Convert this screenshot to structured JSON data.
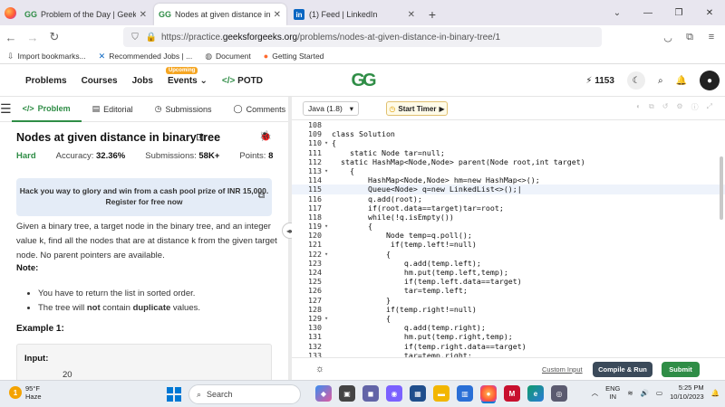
{
  "browser": {
    "tabs": [
      {
        "title": "Problem of the Day | GeeksforG",
        "icon": "gfg"
      },
      {
        "title": "Nodes at given distance in bina",
        "icon": "gfg"
      },
      {
        "title": "(1) Feed | LinkedIn",
        "icon": "linkedin"
      }
    ],
    "url_prefix": "https://practice.",
    "url_domain": "geeksforgeeks.org",
    "url_path": "/problems/nodes-at-given-distance-in-binary-tree/1",
    "bookmarks": [
      "Import bookmarks...",
      "Recommended Jobs | ...",
      "Document",
      "Getting Started"
    ]
  },
  "site": {
    "nav": [
      "Problems",
      "Courses",
      "Jobs",
      "Events",
      "POTD"
    ],
    "events_badge": "Upcoming",
    "logo": "GG",
    "streak": "1153"
  },
  "problem": {
    "tabs": [
      "Problem",
      "Editorial",
      "Submissions",
      "Comments"
    ],
    "title": "Nodes at given distance in binary tree",
    "difficulty": "Hard",
    "accuracy_label": "Accuracy:",
    "accuracy": "32.36%",
    "submissions_label": "Submissions:",
    "submissions": "58K+",
    "points_label": "Points:",
    "points": "8",
    "promo_line1": "Hack you way to glory and win from a cash pool prize of INR 15,000.",
    "promo_line2": "Register for free now",
    "description": "Given a binary tree, a target node in the binary tree, and an integer value k, find all the nodes that are at distance k from the given target node. No parent pointers are available.",
    "note_label": "Note:",
    "note1": "You have to return the list in sorted order.",
    "note2_pre": "The tree will ",
    "note2_not": "not",
    "note2_mid": " contain ",
    "note2_dup": "duplicate",
    "note2_post": " values.",
    "example_label": "Example 1:",
    "input_label": "Input:",
    "input_value": "20"
  },
  "editor": {
    "language": "Java (1.8)",
    "timer_label": "Start Timer",
    "lines": [
      {
        "n": "108",
        "f": "",
        "c": ""
      },
      {
        "n": "109",
        "f": "",
        "c": "class Solution"
      },
      {
        "n": "110",
        "f": "▾",
        "c": "{"
      },
      {
        "n": "111",
        "f": "",
        "c": "    static Node tar=null;"
      },
      {
        "n": "112",
        "f": "",
        "c": "  static HashMap<Node,Node> parent(Node root,int target)"
      },
      {
        "n": "113",
        "f": "▾",
        "c": "    {"
      },
      {
        "n": "114",
        "f": "",
        "c": "        HashMap<Node,Node> hm=new HashMap<>();"
      },
      {
        "n": "115",
        "f": "",
        "c": "        Queue<Node> q=new LinkedList<>();|"
      },
      {
        "n": "116",
        "f": "",
        "c": "        q.add(root);"
      },
      {
        "n": "117",
        "f": "",
        "c": "        if(root.data==target)tar=root;"
      },
      {
        "n": "118",
        "f": "",
        "c": "        while(!q.isEmpty())"
      },
      {
        "n": "119",
        "f": "▾",
        "c": "        {"
      },
      {
        "n": "120",
        "f": "",
        "c": "            Node temp=q.poll();"
      },
      {
        "n": "121",
        "f": "",
        "c": "             if(temp.left!=null)"
      },
      {
        "n": "122",
        "f": "▾",
        "c": "            {"
      },
      {
        "n": "123",
        "f": "",
        "c": "                q.add(temp.left);"
      },
      {
        "n": "124",
        "f": "",
        "c": "                hm.put(temp.left,temp);"
      },
      {
        "n": "125",
        "f": "",
        "c": "                if(temp.left.data==target)"
      },
      {
        "n": "126",
        "f": "",
        "c": "                tar=temp.left;"
      },
      {
        "n": "127",
        "f": "",
        "c": "            }"
      },
      {
        "n": "128",
        "f": "",
        "c": "            if(temp.right!=null)"
      },
      {
        "n": "129",
        "f": "▾",
        "c": "            {"
      },
      {
        "n": "130",
        "f": "",
        "c": "                q.add(temp.right);"
      },
      {
        "n": "131",
        "f": "",
        "c": "                hm.put(temp.right,temp);"
      },
      {
        "n": "132",
        "f": "",
        "c": "                if(temp.right.data==target)"
      },
      {
        "n": "133",
        "f": "",
        "c": "                tar=temp.right;"
      }
    ],
    "custom_input": "Custom Input",
    "compile_label": "Compile & Run",
    "submit_label": "Submit"
  },
  "taskbar": {
    "temp": "95°F",
    "weather": "Haze",
    "search_placeholder": "Search",
    "lang_top": "ENG",
    "lang_bottom": "IN",
    "time": "5:25 PM",
    "date": "10/10/2023"
  },
  "colors": {
    "accent": "#2f8d46",
    "compile": "#3b4a5a",
    "promo_bg": "#e4ecf7"
  }
}
